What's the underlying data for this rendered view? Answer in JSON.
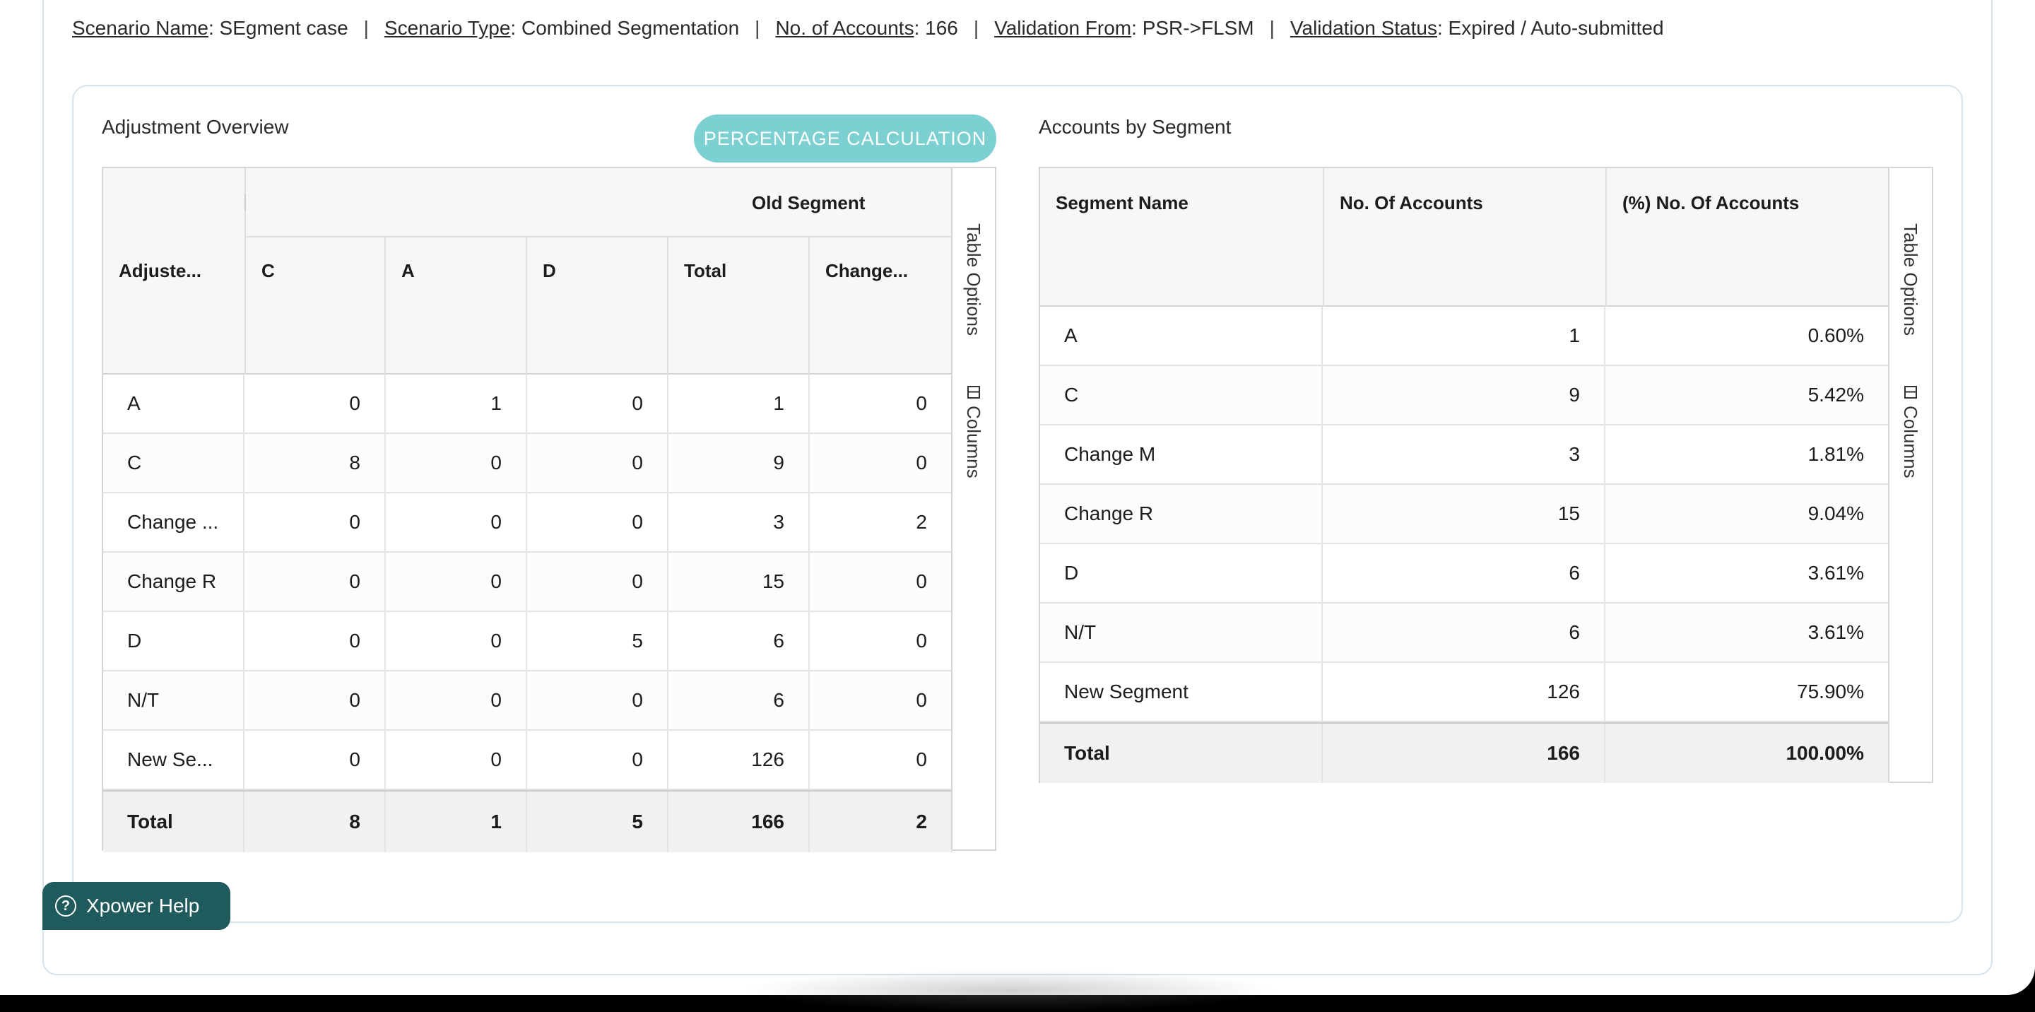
{
  "info_bar": {
    "scenario_name_label": "Scenario Name",
    "scenario_name_value": ": SEgment case",
    "scenario_type_label": "Scenario Type",
    "scenario_type_value": ": Combined Segmentation",
    "accounts_label": "No. of Accounts",
    "accounts_value": ": 166",
    "validation_from_label": "Validation From",
    "validation_from_value": ": PSR->FLSM",
    "validation_status_label": "Validation Status",
    "validation_status_value": ": Expired / Auto-submitted",
    "separator": "|"
  },
  "adjustment": {
    "title": "Adjustment Overview",
    "button_label": "PERCENTAGE CALCULATION",
    "group_header": "Old Segment",
    "columns": [
      "Adjuste...",
      "C",
      "A",
      "D",
      "Total",
      "Change..."
    ],
    "rows": [
      [
        "A",
        "0",
        "1",
        "0",
        "1",
        "0"
      ],
      [
        "C",
        "8",
        "0",
        "0",
        "9",
        "0"
      ],
      [
        "Change ...",
        "0",
        "0",
        "0",
        "3",
        "2"
      ],
      [
        "Change R",
        "0",
        "0",
        "0",
        "15",
        "0"
      ],
      [
        "D",
        "0",
        "0",
        "5",
        "6",
        "0"
      ],
      [
        "N/T",
        "0",
        "0",
        "0",
        "6",
        "0"
      ],
      [
        "New Se...",
        "0",
        "0",
        "0",
        "126",
        "0"
      ]
    ],
    "total": [
      "Total",
      "8",
      "1",
      "5",
      "166",
      "2"
    ],
    "side_table_options": "Table Options",
    "side_columns": "Columns"
  },
  "segments": {
    "title": "Accounts by Segment",
    "columns": [
      "Segment Name",
      "No. Of Accounts",
      "(%) No. Of Accounts"
    ],
    "rows": [
      [
        "A",
        "1",
        "0.60%"
      ],
      [
        "C",
        "9",
        "5.42%"
      ],
      [
        "Change M",
        "3",
        "1.81%"
      ],
      [
        "Change R",
        "15",
        "9.04%"
      ],
      [
        "D",
        "6",
        "3.61%"
      ],
      [
        "N/T",
        "6",
        "3.61%"
      ],
      [
        "New Segment",
        "126",
        "75.90%"
      ]
    ],
    "total": [
      "Total",
      "166",
      "100.00%"
    ],
    "side_table_options": "Table Options",
    "side_columns": "Columns"
  },
  "help": {
    "label": "Xpower Help",
    "icon": "question-circle-icon"
  }
}
